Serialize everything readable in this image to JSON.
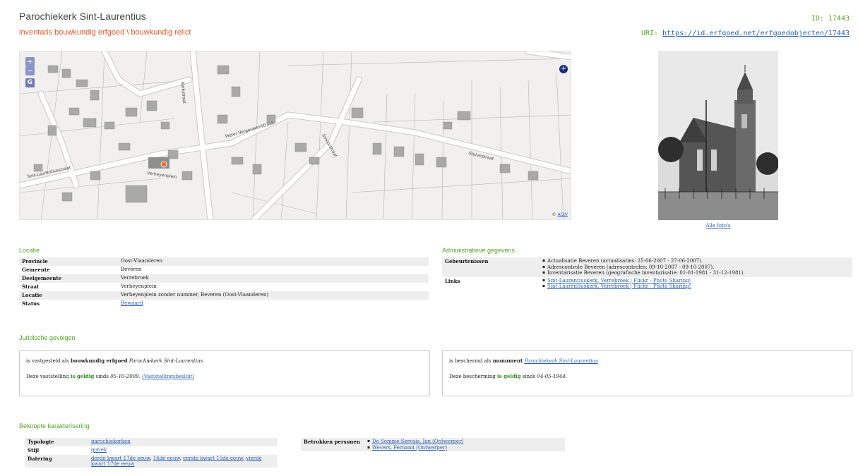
{
  "header": {
    "title": "Parochiekerk Sint-Laurentius",
    "subtitle": "inventaris bouwkundig erfgoed \\ bouwkundig relict",
    "id_label": "ID: 17443",
    "uri_label": "URI: ",
    "uri_link": "https://id.erfgoed.net/erfgoedobjecten/17443"
  },
  "map": {
    "zoom_in": "+",
    "zoom_out": "−",
    "geo_button": "G",
    "plus_button": "+",
    "attribution_prefix": "© ",
    "attribution_link": "AGIV",
    "street_labels": [
      "Sint-Laurentiusstraat",
      "Verheyenplein",
      "Pieter Vergauwenstraat",
      "Kerkstraat",
      "Stuivestraat",
      "Smoorstraat"
    ],
    "colors": {
      "road": "#ffffff",
      "building": "#a9a9a9",
      "background": "#f1f0ee",
      "marker": "#e8732a"
    }
  },
  "photo": {
    "link": "Alle foto's"
  },
  "locatie": {
    "title": "Locatie",
    "rows": [
      {
        "key": "Provincie",
        "value": "Oost-Vlaanderen"
      },
      {
        "key": "Gemeente",
        "value": "Beveren"
      },
      {
        "key": "Deelgemeente",
        "value": "Verrebroek"
      },
      {
        "key": "Straat",
        "value": "Verheyenplein"
      },
      {
        "key": "Locatie",
        "value": "Verheyenplein zonder nummer, Beveren (Oost-Vlaanderen)"
      },
      {
        "key": "Status",
        "value": "Bewaard"
      }
    ]
  },
  "admin": {
    "title": "Administratieve gegevens",
    "gebeurtenissen_key": "Gebeurtenissen",
    "gebeurtenissen": [
      "Actualisatie Beveren (actualisaties: 25-06-2007 - 27-06-2007).",
      "Adrescontrole Beveren (adrescontroles: 09-10-2007 - 09-10-2007).",
      "Inventarisatie Beveren (geografische inventarisatie: 01-01-1981 - 31-12-1981)."
    ],
    "links_key": "Links",
    "links": [
      "Sint-Laurentiuskerk, Verrebroek | Flickr - Photo Sharing!",
      "Sint-Laurentiuskerk, Verrebroek | Flickr - Photo Sharing!"
    ]
  },
  "juridisch": {
    "title": "Juridische gevolgen",
    "left": {
      "l1_prefix": "is vastgesteld als ",
      "l1_bold": "bouwkundig erfgoed",
      "l1_italic": "Parochiekerk Sint-Laurentius",
      "l2_prefix": "Deze vaststelling ",
      "l2_green": "is geldig",
      "l2_mid": " sinds ",
      "l2_date": "05-10-2009",
      "l2_after": ". ",
      "l2_link": "(Vaststellingsbesluit)"
    },
    "right": {
      "l1_prefix": "is beschermd als ",
      "l1_bold": "monument",
      "l1_link": "Parochiekerk Sint-Laurentius",
      "l2_prefix": "Deze bescherming ",
      "l2_green": "is geldig",
      "l2_mid": " sinds ",
      "l2_date": "04-05-1944",
      "l2_after": "."
    }
  },
  "karakter": {
    "title": "Beknopte karakterisering",
    "typologie_key": "Typologie",
    "typologie": "parochiekerken",
    "stijl_key": "Stijl",
    "stijl": "gotiek",
    "datering_key": "Datering",
    "datering": [
      "derde kwart 17de eeuw",
      "16de eeuw",
      "eerste kwart 15de eeuw",
      "vierde kwart 17de eeuw"
    ],
    "datering_sep": ", ",
    "personen_key": "Betrokken personen",
    "personen": [
      "De Somme-Servais, Jan (Ontwerper)",
      "Wevers, Fernand (Ontwerper)"
    ]
  }
}
